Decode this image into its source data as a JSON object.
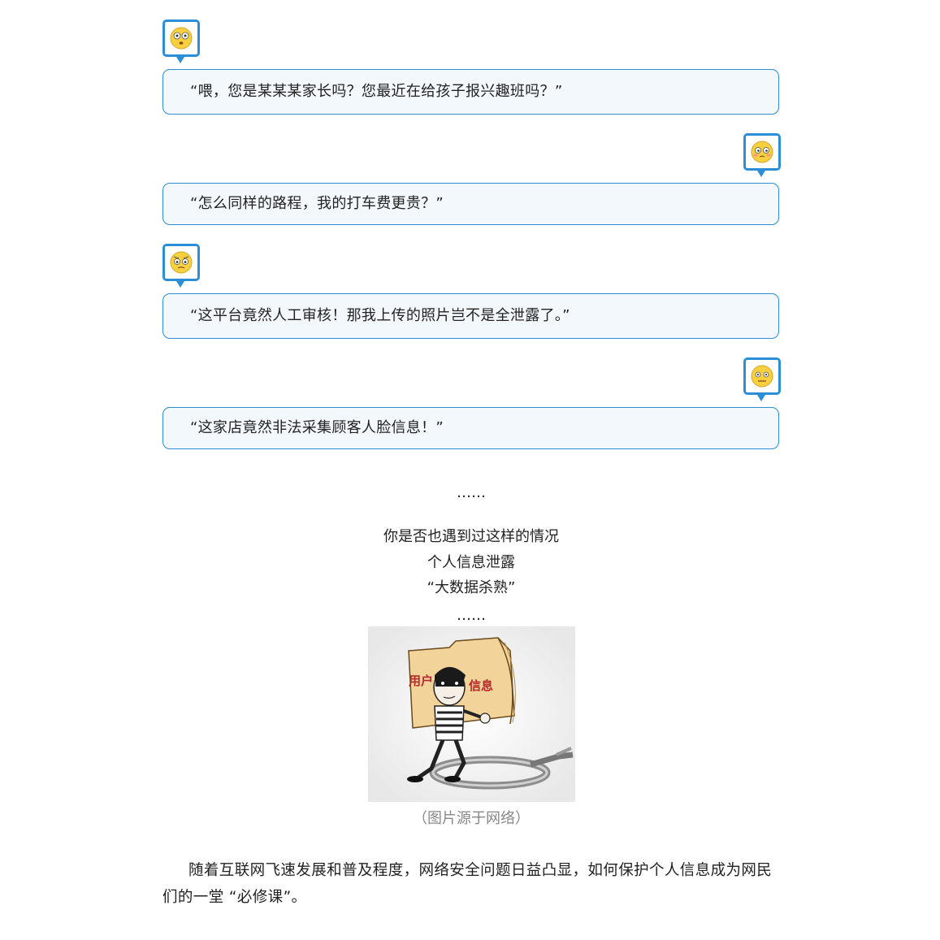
{
  "dialogues": [
    {
      "text": "“喂，您是某某某家长吗？您最近在给孩子报兴趣班吗？”",
      "avatar_side": "left",
      "icon": "confused-face-icon"
    },
    {
      "text": "“怎么同样的路程，我的打车费更贵？”",
      "avatar_side": "right",
      "icon": "flushed-face-icon"
    },
    {
      "text": "“这平台竟然人工审核！那我上传的照片岂不是全泄露了。”",
      "avatar_side": "left",
      "icon": "worried-face-icon"
    },
    {
      "text": "“这家店竟然非法采集顾客人脸信息！”",
      "avatar_side": "right",
      "icon": "shocked-face-icon"
    }
  ],
  "ellipsis_1": "……",
  "summary_lines": [
    "你是否也遇到过这样的情况",
    "个人信息泄露",
    "“大数据杀熟”",
    "……"
  ],
  "illustration": {
    "folder_label_left": "用户",
    "folder_label_right": "信息"
  },
  "caption": "（图片源于网络）",
  "paragraph": "随着互联网飞速发展和普及程度，网络安全问题日益凸显，如何保护个人信息成为网民们的一堂 “必修课”。",
  "colors": {
    "accent": "#2d8ed8",
    "bubble_bg": "#f3f8fd",
    "caption": "#888888"
  }
}
